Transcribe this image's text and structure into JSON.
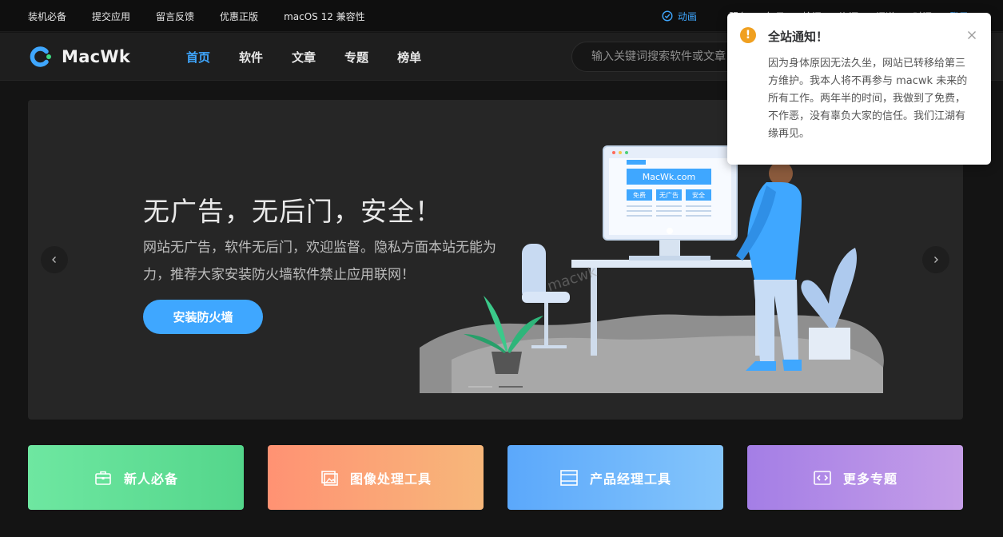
{
  "topbar": {
    "links": [
      "装机必备",
      "提交应用",
      "留言反馈",
      "优惠正版",
      "macOS 12 兼容性"
    ],
    "animation_label": "动画",
    "partial_links": [
      "服务",
      "每日",
      "检阅",
      "资源",
      "问道",
      "时间",
      "登录"
    ]
  },
  "nav": {
    "logo_text": "MacWk",
    "menu": [
      "首页",
      "软件",
      "文章",
      "专题",
      "榜单"
    ],
    "search_placeholder": "输入关键词搜索软件或文章"
  },
  "banner": {
    "title": "无广告，无后门，安全！",
    "description": "网站无广告，软件无后门，欢迎监督。隐私方面本站无能为力，推荐大家安装防火墙软件禁止应用联网！",
    "cta": "安装防火墙",
    "illustration": {
      "screen_site": "MacWk.com",
      "screen_tags": [
        "免费",
        "无广告",
        "安全"
      ],
      "watermark": "macwk"
    }
  },
  "categories": [
    {
      "label": "新人必备",
      "icon": "briefcase-icon",
      "color": "#5edd93"
    },
    {
      "label": "图像处理工具",
      "icon": "image-icon",
      "color": "#fba175"
    },
    {
      "label": "产品经理工具",
      "icon": "window-icon",
      "color": "#6eb5fb"
    },
    {
      "label": "更多专题",
      "icon": "code-icon",
      "color": "#b38ee7"
    }
  ],
  "notice": {
    "title": "全站通知！",
    "body": "因为身体原因无法久坐，网站已转移给第三方维护。我本人将不再参与 macwk 未来的所有工作。两年半的时间，我做到了免费，不作恶，没有辜负大家的信任。我们江湖有缘再见。"
  },
  "colors": {
    "accent": "#3fa7ff",
    "warning": "#f0a020"
  }
}
